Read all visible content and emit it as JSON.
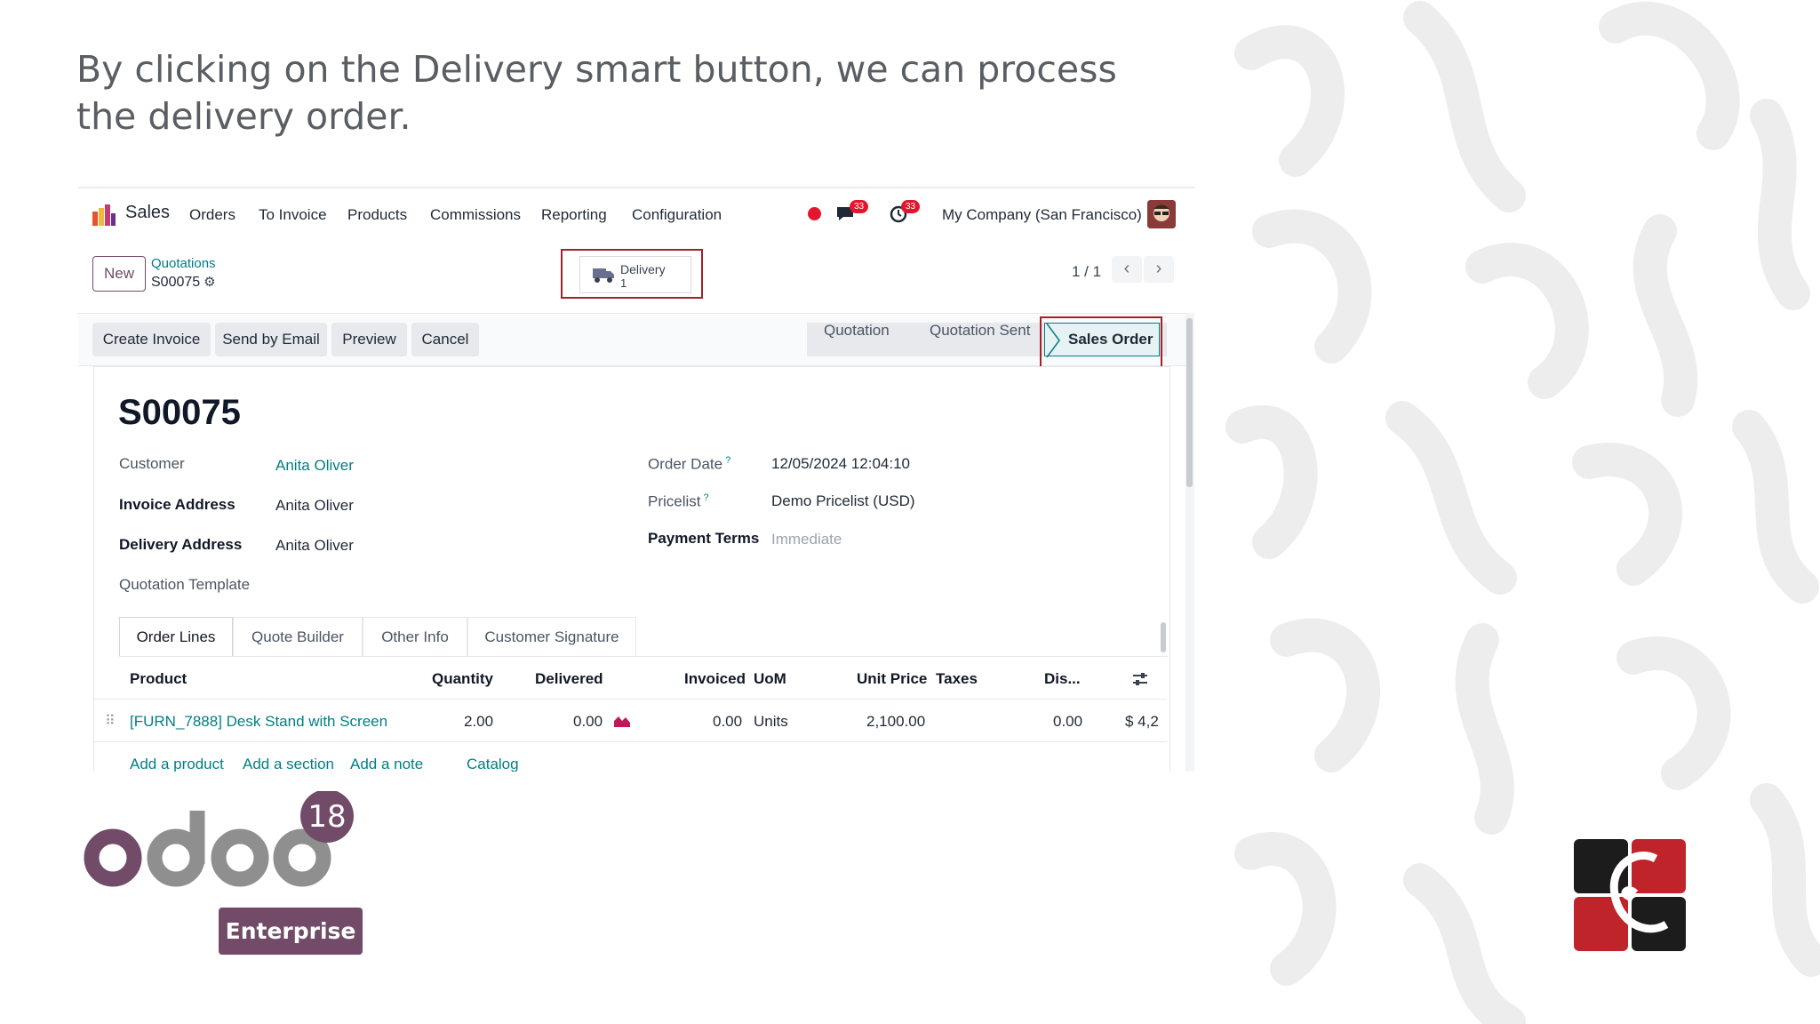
{
  "caption": "By clicking on the Delivery smart button, we can process the delivery order.",
  "navbar": {
    "app_name": "Sales",
    "menu": [
      "Orders",
      "To Invoice",
      "Products",
      "Commissions",
      "Reporting",
      "Configuration"
    ],
    "messages_count": "33",
    "activities_count": "33",
    "company": "My Company (San Francisco)"
  },
  "control_panel": {
    "new_label": "New",
    "breadcrumb": "Quotations",
    "record_name": "S00075",
    "smart_button": {
      "label": "Delivery",
      "count": "1"
    },
    "pager": "1 / 1"
  },
  "actions": [
    "Create Invoice",
    "Send by Email",
    "Preview",
    "Cancel"
  ],
  "statusbar": {
    "states": [
      "Quotation",
      "Quotation Sent",
      "Sales Order"
    ],
    "current": "Sales Order"
  },
  "form": {
    "title": "S00075",
    "left": [
      {
        "label": "Customer",
        "value": "Anita Oliver"
      },
      {
        "label": "Invoice Address",
        "value": "Anita Oliver"
      },
      {
        "label": "Delivery Address",
        "value": "Anita Oliver"
      },
      {
        "label": "Quotation Template",
        "value": ""
      }
    ],
    "right": [
      {
        "label": "Order Date",
        "value": "12/05/2024 12:04:10"
      },
      {
        "label": "Pricelist",
        "value": "Demo Pricelist (USD)"
      },
      {
        "label": "Payment Terms",
        "value": "Immediate"
      }
    ]
  },
  "tabs": [
    "Order Lines",
    "Quote Builder",
    "Other Info",
    "Customer Signature"
  ],
  "table": {
    "columns": [
      "Product",
      "Quantity",
      "Delivered",
      "Invoiced",
      "UoM",
      "Unit Price",
      "Taxes",
      "Dis..."
    ],
    "rows": [
      {
        "product": "[FURN_7888] Desk Stand with Screen",
        "quantity": "2.00",
        "delivered": "0.00",
        "invoiced": "0.00",
        "uom": "Units",
        "unit_price": "2,100.00",
        "taxes": "",
        "discount": "0.00",
        "subtotal": "$ 4,2"
      }
    ],
    "add_links": [
      "Add a product",
      "Add a section",
      "Add a note",
      "Catalog"
    ]
  },
  "branding": {
    "product": "odoo",
    "version": "18",
    "edition": "Enterprise",
    "accent": "#714b67",
    "partner_logo_colors": [
      "#1c1c1c",
      "#c0242b"
    ]
  }
}
